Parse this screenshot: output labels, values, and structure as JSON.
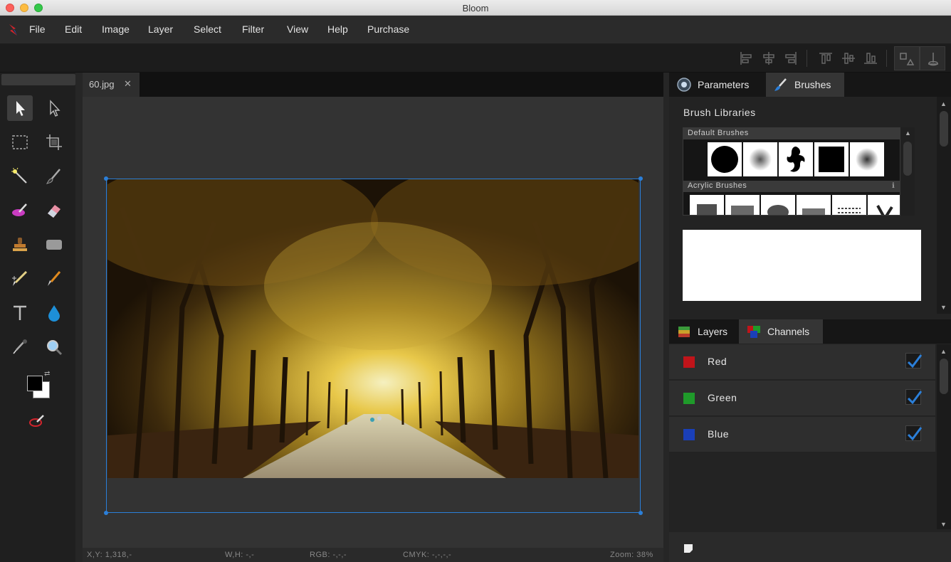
{
  "window": {
    "title": "Bloom"
  },
  "menu": {
    "items": [
      "File",
      "Edit",
      "Image",
      "Layer",
      "Select",
      "Filter",
      "View",
      "Help",
      "Purchase"
    ]
  },
  "document": {
    "tab_label": "60.jpg",
    "tab_close": "✕"
  },
  "statusbar": {
    "xy": "X,Y:  1,318,-",
    "wh": "W,H:  -,-",
    "rgb": "RGB:  -,-,-",
    "cmyk": "CMYK:  -,-,-,-",
    "zoom": "Zoom:  38%"
  },
  "panels": {
    "top_tabs": [
      {
        "label": "Parameters",
        "icon": "parameters-icon"
      },
      {
        "label": "Brushes",
        "icon": "brush-icon"
      }
    ],
    "brushes": {
      "section_title": "Brush  Libraries",
      "libraries": [
        {
          "name": "Default Brushes"
        },
        {
          "name": "Acrylic Brushes"
        }
      ]
    },
    "bottom_tabs": [
      {
        "label": "Layers",
        "icon": "layers-icon"
      },
      {
        "label": "Channels",
        "icon": "channels-icon"
      }
    ],
    "channels": [
      {
        "name": "Red",
        "color": "#c0141a",
        "checked": true
      },
      {
        "name": "Green",
        "color": "#1f9a2a",
        "checked": true
      },
      {
        "name": "Blue",
        "color": "#1a3fb8",
        "checked": true
      }
    ]
  },
  "colors": {
    "accent": "#2b7fd9",
    "foreground": "#000000",
    "background": "#ffffff"
  }
}
